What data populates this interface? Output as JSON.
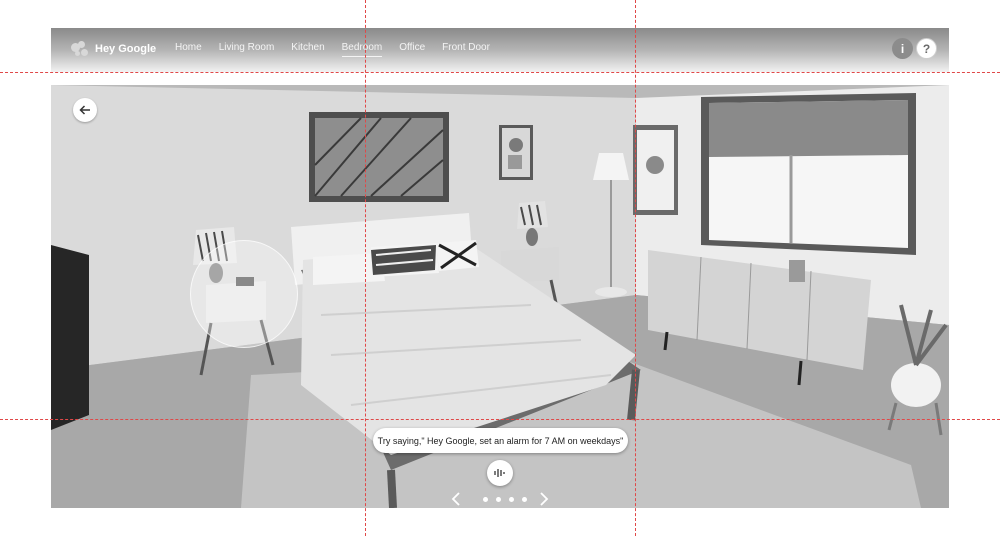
{
  "header": {
    "brand_title": "Hey Google",
    "nav_items": [
      "Home",
      "Living Room",
      "Kitchen",
      "Bedroom",
      "Office",
      "Front Door"
    ],
    "active_tab": "Bedroom",
    "info_label": "i",
    "help_label": "?"
  },
  "scene": {
    "room": "Bedroom",
    "suggestion_text": "Try saying,\" Hey Google, set an alarm for 7 AM on weekdays\"",
    "carousel": {
      "slide_count": 4,
      "active_index": 0
    }
  },
  "icons": {
    "back": "arrow-left-icon",
    "mic": "voice-wave-icon",
    "prev": "chevron-left-icon",
    "next": "chevron-right-icon"
  },
  "colors": {
    "header_top": "#8a8a8a",
    "accent_guides": "#e04848",
    "chip_background": "#ffffff"
  }
}
